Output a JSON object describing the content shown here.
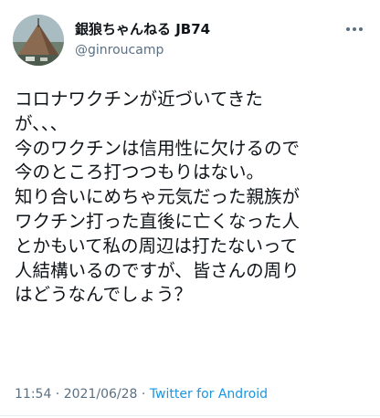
{
  "tweet": {
    "display_name": "銀狼ちゃんねる JB74",
    "handle": "@ginroucamp",
    "text_lines": [
      "コロナワクチンが近づいてきた",
      "が、、、",
      "今のワクチンは信用性に欠けるので",
      "今のところ打つつもりはない。",
      "知り合いにめちゃ元気だった親族が",
      "ワクチン打った直後に亡くなった人",
      "とかもいて私の周辺は打たないって",
      "人結構いるのですが、皆さんの周り",
      "はどうなんでしょう？"
    ],
    "time": "11:54",
    "separator1": " · ",
    "date": "2021/06/28",
    "separator2": " · ",
    "source": "Twitter for Android"
  },
  "icons": {
    "avatar": "avatar-photo-tent",
    "more": "more-dots-icon"
  },
  "colors": {
    "text": "#0f1419",
    "secondary": "#5b7083",
    "link": "#1b95e0"
  }
}
